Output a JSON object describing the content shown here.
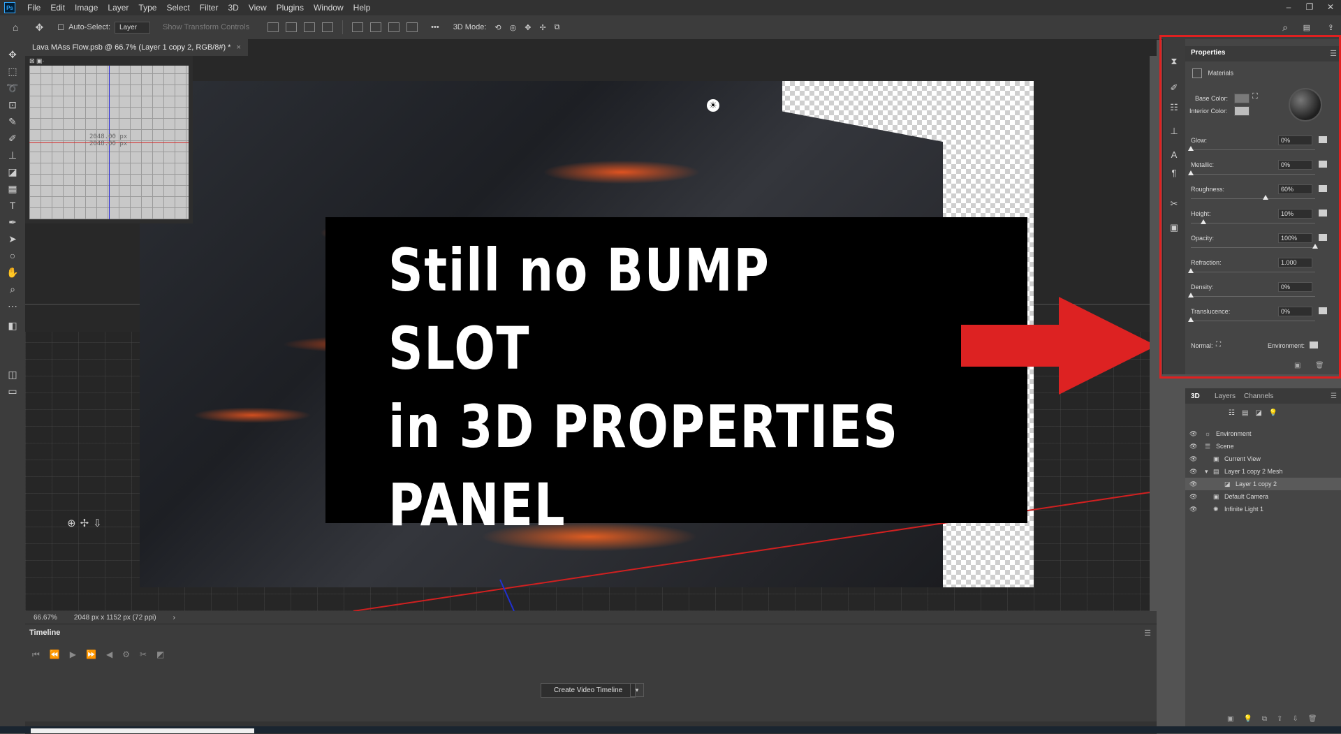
{
  "app": {
    "logo": "Ps"
  },
  "menu": [
    "File",
    "Edit",
    "Image",
    "Layer",
    "Type",
    "Select",
    "Filter",
    "3D",
    "View",
    "Plugins",
    "Window",
    "Help"
  ],
  "options_bar": {
    "auto_select_label": "Auto-Select:",
    "auto_select_value": "Layer",
    "transform_label": "Show Transform Controls",
    "more_label": "•••",
    "mode_label": "3D Mode:"
  },
  "document": {
    "tab_title": "Lava MAss Flow.psb @ 66.7% (Layer 1 copy 2, RGB/8#) *",
    "close": "×"
  },
  "mini_view": {
    "dims_line1": "2048.00 px",
    "dims_line2": "2048.00 px"
  },
  "banner": {
    "text": "Still no BUMP SLOT\nin 3D PROPERTIES\nPANEL"
  },
  "status_bar": {
    "zoom": "66.67%",
    "doc_info": "2048 px x 1152 px (72 ppi)"
  },
  "timeline": {
    "tab_label": "Timeline",
    "create_button": "Create Video Timeline"
  },
  "properties": {
    "title": "Properties",
    "materials_label": "Materials",
    "base_color_label": "Base Color:",
    "interior_color_label": "Interior Color:",
    "rows": [
      {
        "label": "Glow:",
        "value": "0%",
        "level": 0.0
      },
      {
        "label": "Metallic:",
        "value": "0%",
        "level": 0.0
      },
      {
        "label": "Roughness:",
        "value": "60%",
        "level": 0.6
      },
      {
        "label": "Height:",
        "value": "10%",
        "level": 0.1
      },
      {
        "label": "Opacity:",
        "value": "100%",
        "level": 1.0
      },
      {
        "label": "Refraction:",
        "value": "1.000",
        "level": 0.0
      },
      {
        "label": "Density:",
        "value": "0%",
        "level": 0.0
      },
      {
        "label": "Translucence:",
        "value": "0%",
        "level": 0.0
      }
    ],
    "normal_label": "Normal:",
    "environment_label": "Environment:"
  },
  "panel3d": {
    "tabs": [
      "3D",
      "Layers",
      "Channels"
    ],
    "scene": [
      {
        "label": "Environment"
      },
      {
        "label": "Scene"
      },
      {
        "label": "Current View"
      },
      {
        "label": "Layer 1 copy 2 Mesh"
      },
      {
        "label": "Layer 1 copy 2"
      },
      {
        "label": "Default Camera"
      },
      {
        "label": "Infinite Light 1"
      }
    ]
  },
  "colors": {
    "highlight_red": "#e02020",
    "arrow_red": "#dd2222",
    "accent_blue": "#31a8ff"
  }
}
